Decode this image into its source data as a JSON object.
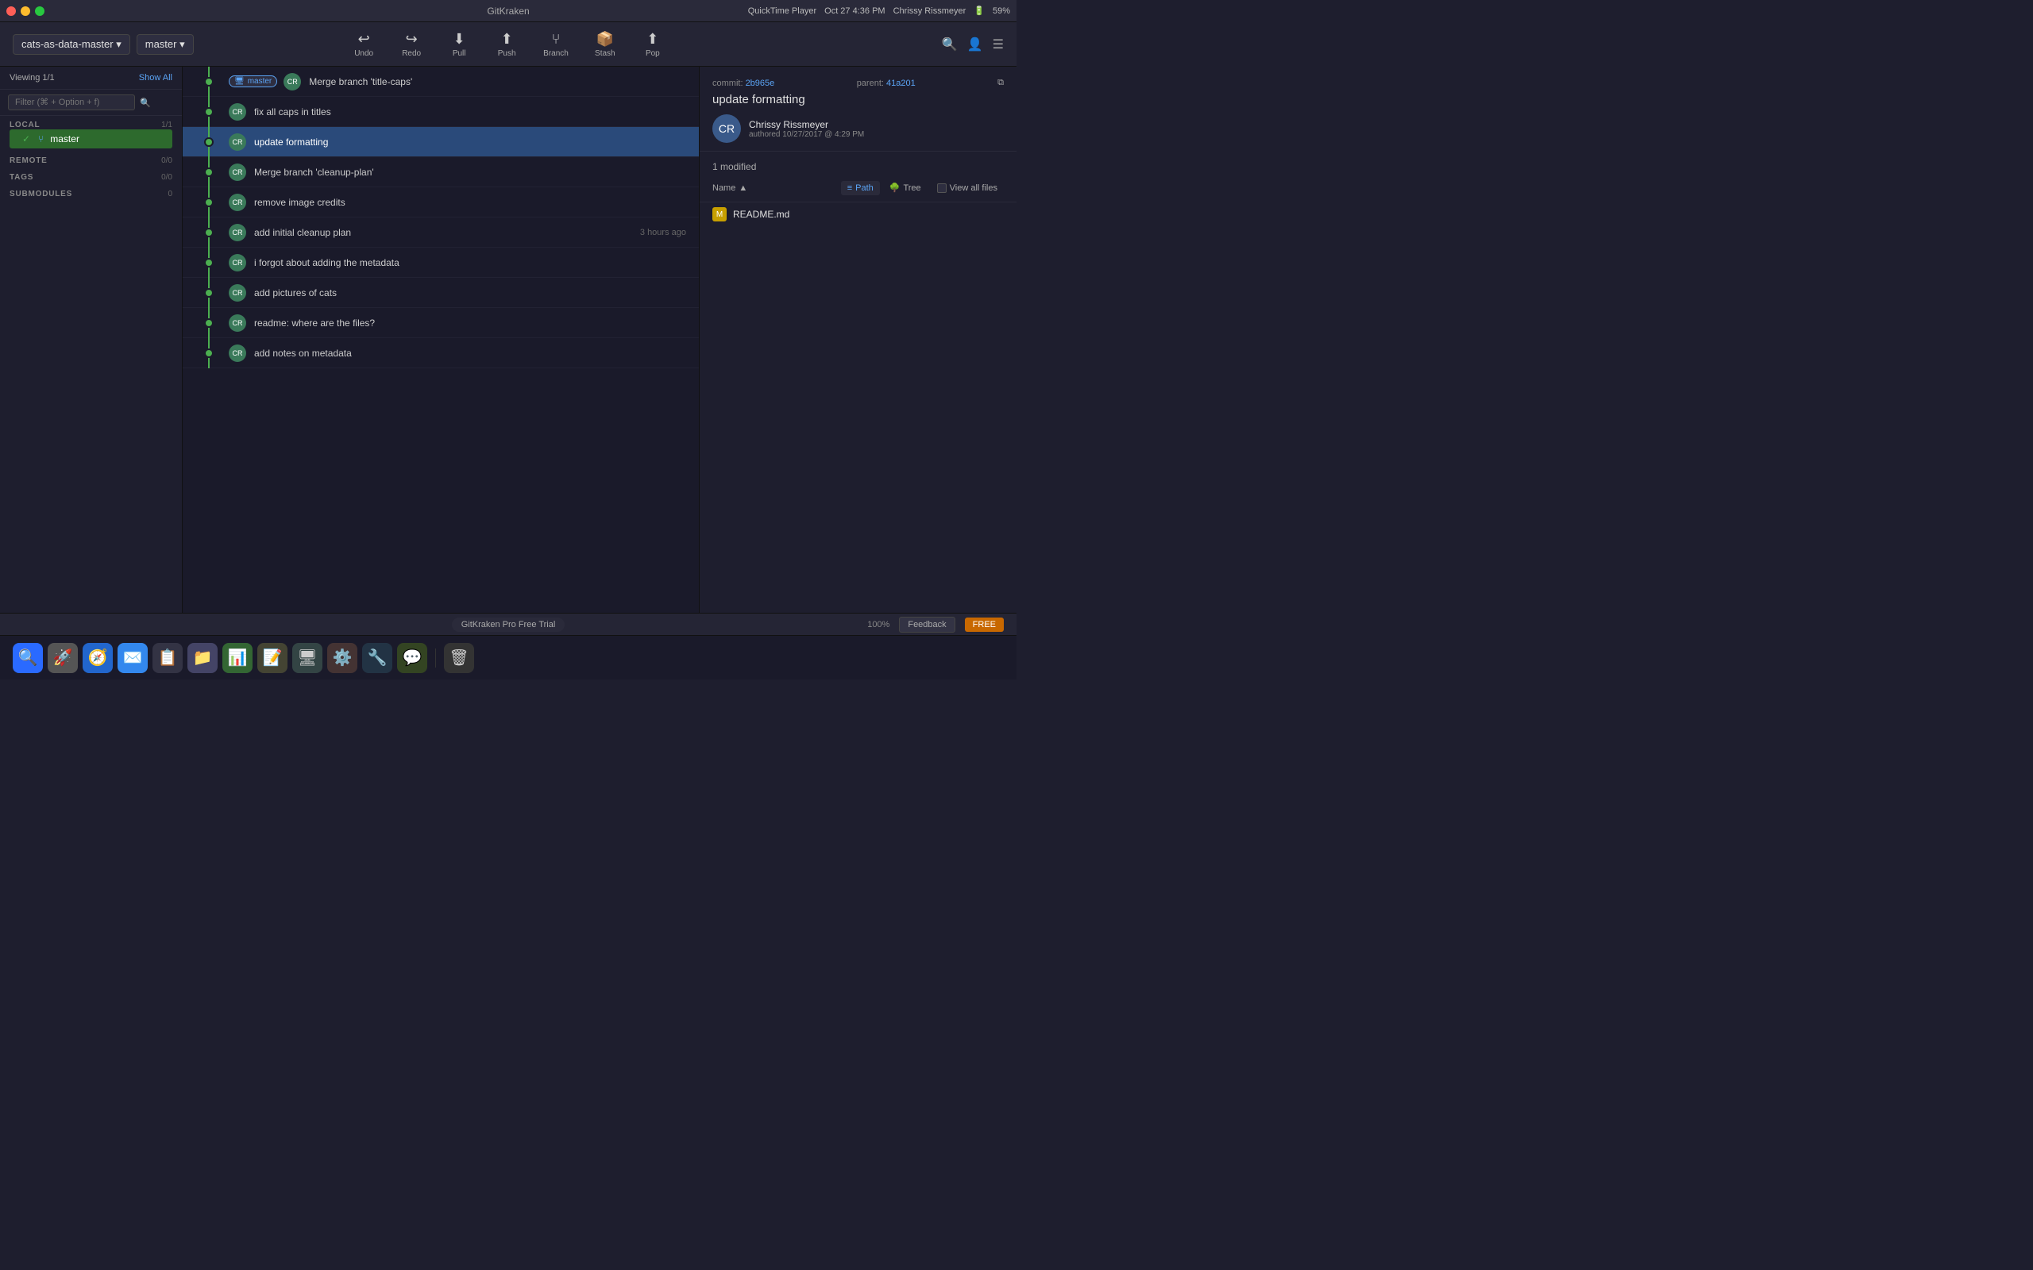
{
  "titlebar": {
    "app_name": "QuickTime Player",
    "title": "GitKraken",
    "system_info": "Oct 27  4:36 PM",
    "user": "Chrissy Rissmeyer",
    "battery": "59%"
  },
  "toolbar": {
    "repo_name": "cats-as-data-master",
    "branch_name": "master",
    "buttons": [
      {
        "icon": "↩",
        "label": "Undo"
      },
      {
        "icon": "↪",
        "label": "Redo"
      },
      {
        "icon": "⬇",
        "label": "Pull"
      },
      {
        "icon": "⬆",
        "label": "Push"
      },
      {
        "icon": "⑂",
        "label": "Branch"
      },
      {
        "icon": "📦",
        "label": "Stash"
      },
      {
        "icon": "⬆",
        "label": "Pop"
      }
    ]
  },
  "sidebar": {
    "viewing_text": "Viewing 1/1",
    "show_all": "Show All",
    "filter_placeholder": "Filter (⌘ + Option + f)",
    "sections": [
      {
        "title": "LOCAL",
        "count": "1/1"
      },
      {
        "title": "REMOTE",
        "count": "0/0"
      },
      {
        "title": "TAGS",
        "count": "0/0"
      },
      {
        "title": "SUBMODULES",
        "count": "0"
      }
    ],
    "local_branch": "master"
  },
  "commits": [
    {
      "id": 1,
      "message": "Merge branch 'title-caps'",
      "time": "",
      "selected": false,
      "branch_tag": "master",
      "is_merge": true
    },
    {
      "id": 2,
      "message": "fix all caps in titles",
      "time": "",
      "selected": false,
      "is_merge": false
    },
    {
      "id": 3,
      "message": "update formatting",
      "time": "",
      "selected": true,
      "is_merge": false
    },
    {
      "id": 4,
      "message": "Merge branch 'cleanup-plan'",
      "time": "",
      "selected": false,
      "is_merge": true
    },
    {
      "id": 5,
      "message": "remove image credits",
      "time": "",
      "selected": false,
      "is_merge": false
    },
    {
      "id": 6,
      "message": "add initial cleanup plan",
      "time": "3 hours ago",
      "selected": false,
      "is_merge": false
    },
    {
      "id": 7,
      "message": "i forgot about adding the metadata",
      "time": "",
      "selected": false,
      "is_merge": false
    },
    {
      "id": 8,
      "message": "add pictures of cats",
      "time": "",
      "selected": false,
      "is_merge": false
    },
    {
      "id": 9,
      "message": "readme: where are the files?",
      "time": "",
      "selected": false,
      "is_merge": false
    },
    {
      "id": 10,
      "message": "add notes on metadata",
      "time": "",
      "selected": false,
      "is_merge": false
    }
  ],
  "right_panel": {
    "commit_title": "update formatting",
    "commit_hash_label": "commit:",
    "commit_hash": "2b965e",
    "parent_label": "parent:",
    "parent_hash": "41a201",
    "author_name": "Chrissy Rissmeyer",
    "authored_label": "authored",
    "authored_time": "10/27/2017 @ 4:29 PM",
    "modified_count": "1 modified",
    "name_col": "Name",
    "path_label": "Path",
    "tree_label": "Tree",
    "view_all_label": "View all files",
    "file": "README.md"
  },
  "bottom_bar": {
    "trial_text": "GitKraken Pro Free Trial",
    "zoom": "100%",
    "feedback": "Feedback",
    "free": "FREE"
  }
}
